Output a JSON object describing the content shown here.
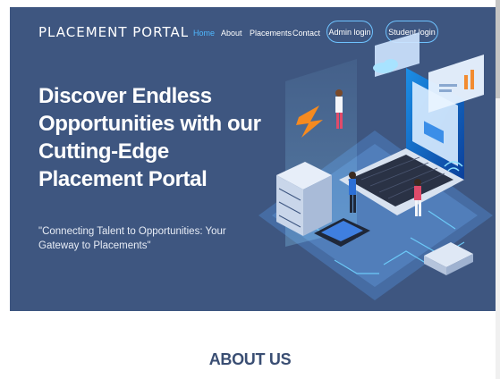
{
  "header": {
    "brand": "PLACEMENT PORTAL",
    "nav": [
      {
        "label": "Home",
        "active": true
      },
      {
        "label": "About",
        "active": false
      },
      {
        "label": "Placements",
        "active": false
      },
      {
        "label": "Contact",
        "active": false
      }
    ],
    "admin_login_label": "Admin login",
    "student_login_label": "Student login"
  },
  "hero": {
    "headline": "Discover Endless Opportunities with our Cutting-Edge Placement Portal",
    "tagline": "\"Connecting Talent to Opportunities: Your Gateway to Placements\"",
    "illustration": "isometric-tech-illustration-icon"
  },
  "about": {
    "title": "ABOUT US"
  },
  "colors": {
    "hero_bg": "#3e5680",
    "accent": "#4fb8ff",
    "about_title": "#3a4e73"
  }
}
